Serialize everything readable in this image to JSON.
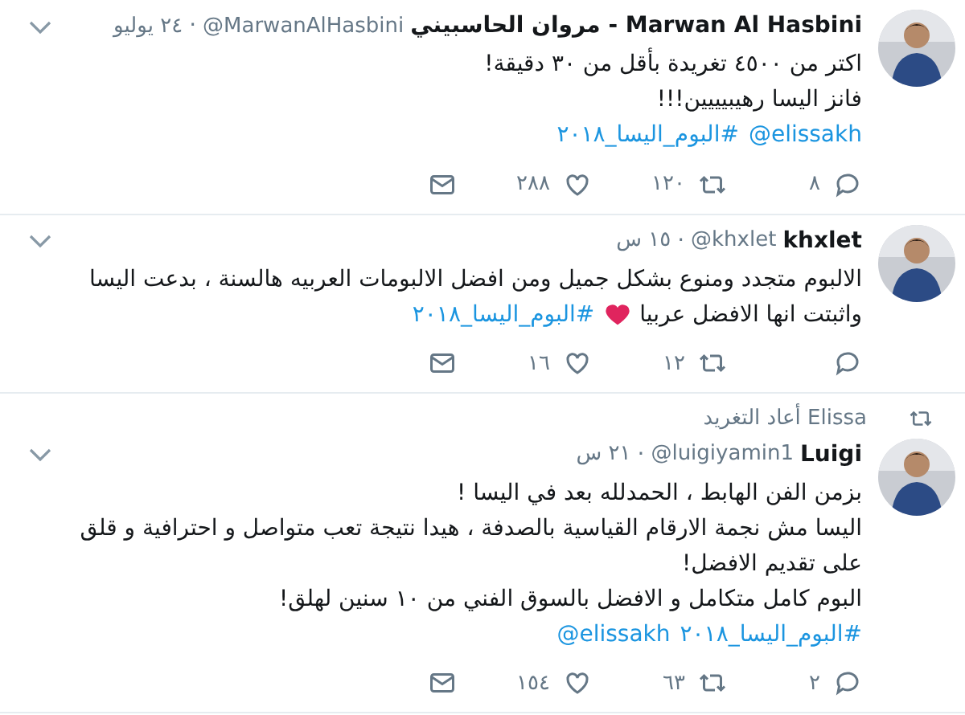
{
  "tweets": [
    {
      "name": "Marwan Al Hasbini - مروان الحاسبيني",
      "handle": "@MarwanAlHasbini",
      "separator": "·",
      "time": "٢٤ يوليو",
      "lines": [
        [
          {
            "kind": "text",
            "text": "اكتر من ٤٥٠٠ تغريدة بأقل من ٣٠ دقيقة!"
          }
        ],
        [
          {
            "kind": "text",
            "text": "فانز اليسا رهيبيييين!!!"
          }
        ],
        [
          {
            "kind": "link",
            "text": "@elissakh"
          },
          {
            "kind": "link",
            "text": "#البوم_اليسا_٢٠١٨"
          }
        ]
      ],
      "replies": "٨",
      "retweets": "١٢٠",
      "likes": "٢٨٨"
    },
    {
      "name": "khxlet",
      "handle": "@khxlet",
      "separator": "·",
      "time": "١٥ س",
      "lines": [
        [
          {
            "kind": "text",
            "text": "الالبوم متجدد ومنوع بشكل جميل ومن افضل الالبومات العربيه هالسنة ، بدعت اليسا"
          }
        ],
        [
          {
            "kind": "text",
            "text": "واثبتت انها الافضل عربيا"
          },
          {
            "kind": "heart"
          },
          {
            "kind": "link",
            "text": "#البوم_اليسا_٢٠١٨"
          }
        ]
      ],
      "retweets": "١٢",
      "likes": "١٦"
    },
    {
      "retweeted_by": "Elissa أعاد التغريد",
      "name": "Luigi",
      "handle": "@luigiyamin1",
      "separator": "·",
      "time": "٢١ س",
      "lines": [
        [
          {
            "kind": "text",
            "text": "بزمن الفن الهابط ، الحمدلله بعد في اليسا !"
          }
        ],
        [
          {
            "kind": "text",
            "text": "اليسا مش نجمة الارقام القياسية بالصدفة ، هيدا نتيجة تعب متواصل و احترافية و قلق"
          }
        ],
        [
          {
            "kind": "text",
            "text": "على تقديم الافضل!"
          }
        ],
        [
          {
            "kind": "text",
            "text": "البوم كامل متكامل و الافضل بالسوق الفني من ١٠ سنين لهلق!"
          }
        ],
        [
          {
            "kind": "link",
            "text": "#البوم_اليسا_٢٠١٨"
          },
          {
            "kind": "link",
            "text": "@elissakh"
          }
        ]
      ],
      "replies": "٢",
      "retweets": "٦٣",
      "likes": "١٥٤"
    }
  ]
}
